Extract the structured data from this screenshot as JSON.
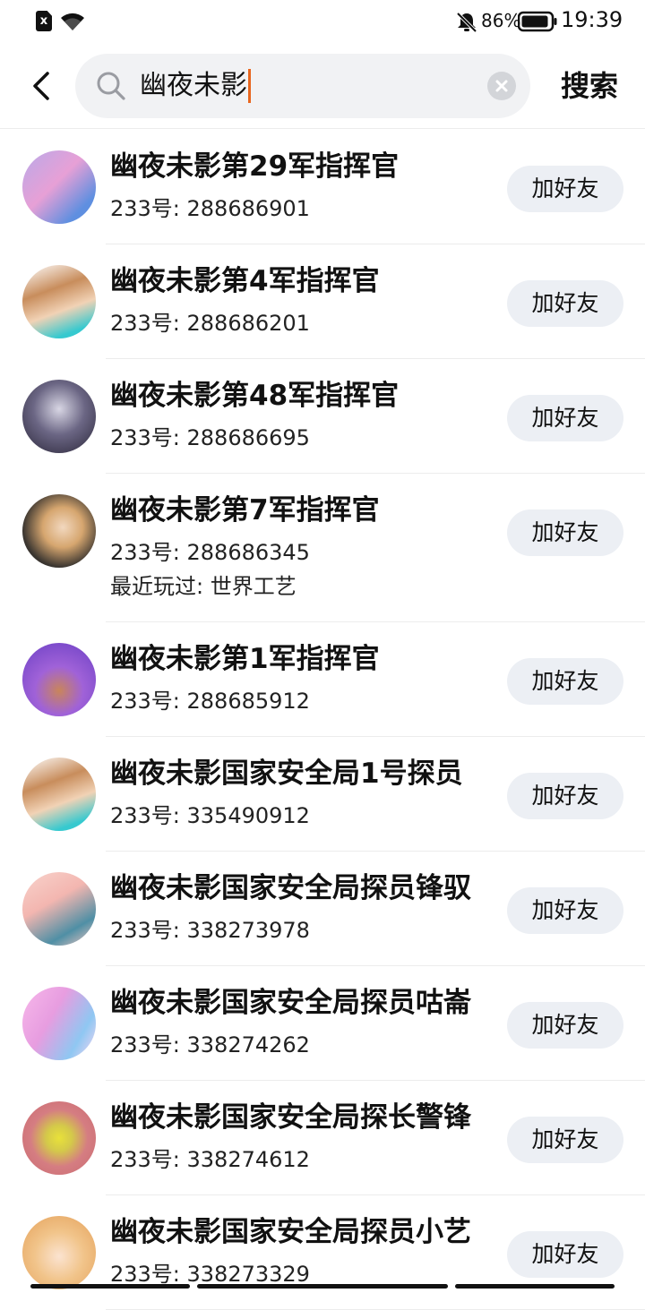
{
  "status_bar": {
    "sim_label": "x",
    "battery": "86%",
    "time": "19:39",
    "icons": [
      "sim-error-icon",
      "wifi-icon",
      "bell-muted-icon",
      "battery-icon"
    ]
  },
  "header": {
    "search_query": "幽夜未影",
    "search_button": "搜索",
    "icons": [
      "back-arrow-icon",
      "search-icon",
      "clear-icon"
    ]
  },
  "results": [
    {
      "name": "幽夜未影第29军指挥官",
      "uid": "233号: 288686901",
      "played": "",
      "button": "加好友",
      "avatar_color": "#b9a9e8"
    },
    {
      "name": "幽夜未影第4军指挥官",
      "uid": "233号: 288686201",
      "played": "",
      "button": "加好友",
      "avatar_color": "#c88d5c"
    },
    {
      "name": "幽夜未影第48军指挥官",
      "uid": "233号: 288686695",
      "played": "",
      "button": "加好友",
      "avatar_color": "#3e3a55"
    },
    {
      "name": "幽夜未影第7军指挥官",
      "uid": "233号: 288686345",
      "played": "最近玩过: 世界工艺",
      "button": "加好友",
      "avatar_color": "#3a3530"
    },
    {
      "name": "幽夜未影第1军指挥官",
      "uid": "233号: 288685912",
      "played": "",
      "button": "加好友",
      "avatar_color": "#8a4fd4"
    },
    {
      "name": "幽夜未影国家安全局1号探员",
      "uid": "233号: 335490912",
      "played": "",
      "button": "加好友",
      "avatar_color": "#c88d5c"
    },
    {
      "name": "幽夜未影国家安全局探员锋驭",
      "uid": "233号: 338273978",
      "played": "",
      "button": "加好友",
      "avatar_color": "#f3b6b0"
    },
    {
      "name": "幽夜未影国家安全局探员咕崙",
      "uid": "233号: 338274262",
      "played": "",
      "button": "加好友",
      "avatar_color": "#e79de0"
    },
    {
      "name": "幽夜未影国家安全局探长警锋",
      "uid": "233号: 338274612",
      "played": "",
      "button": "加好友",
      "avatar_color": "#d57d82"
    },
    {
      "name": "幽夜未影国家安全局探员小艺",
      "uid": "233号: 338273329",
      "played": "",
      "button": "加好友",
      "avatar_color": "#f1c48a"
    }
  ]
}
